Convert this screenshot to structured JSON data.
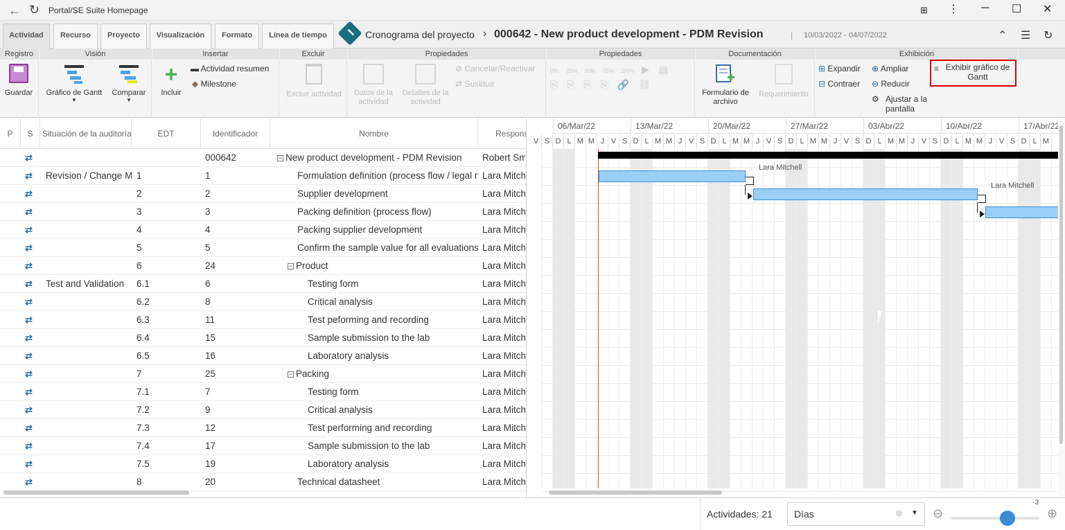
{
  "window": {
    "title": "Portal/SE Suite Homepage"
  },
  "tabs": [
    "Actividad",
    "Recurso",
    "Proyecto",
    "Visualización",
    "Formato",
    "Línea de tiempo"
  ],
  "breadcrumb": {
    "section": "Cronograma del proyecto",
    "separator": "›",
    "project": "000642 - New product development - PDM Revision",
    "divider": "|",
    "dates": "10/03/2022 - 04/07/2022"
  },
  "ribbon": {
    "groups": [
      "Registro",
      "Visión",
      "Insertar",
      "Excluir",
      "Propiedades",
      "Propiedades",
      "Documentación",
      "Exhibición"
    ],
    "guardar": "Guardar",
    "gantt": "Gráfico de Gantt",
    "comparar": "Comparar",
    "incluir": "Incluir",
    "actividad_resumen": "Actividad resumen",
    "milestone": "Milestone",
    "excluir_actividad": "Excluir actividad",
    "datos": "Datos de la actividad",
    "detalles": "Detalles de la actividad",
    "cancelar": "Cancelar/Reactivar",
    "sustituir": "Sustituir",
    "pct": [
      "0%",
      "25%",
      "50%",
      "75%",
      "100%"
    ],
    "formulario": "Formulario de archivo",
    "requerimiento": "Requerimiento",
    "expandir": "Expandir",
    "contraer": "Contraer",
    "ampliar": "Ampliar",
    "reducir": "Reducir",
    "ajustar": "Ajustar a la pantalla",
    "exhibir": "Exhibir gráfico de Gantt"
  },
  "grid": {
    "headers": [
      "P",
      "S",
      "Situación de la auditoría",
      "EDT",
      "Identificador",
      "Nombre",
      "Respons"
    ],
    "rows": [
      {
        "aud": "",
        "edt": "",
        "id": "000642",
        "name": "New product development - PDM Revision",
        "resp": "Robert Smith",
        "level": 0,
        "toggle": "−"
      },
      {
        "aud": "Revision / Change Management",
        "edt": "1",
        "id": "1",
        "name": "Formulation definition (process flow / legal requirements)",
        "resp": "Lara Mitchell",
        "level": 1,
        "toggle": ""
      },
      {
        "aud": "",
        "edt": "2",
        "id": "2",
        "name": "Supplier development",
        "resp": "Lara Mitchell",
        "level": 1,
        "toggle": ""
      },
      {
        "aud": "",
        "edt": "3",
        "id": "3",
        "name": "Packing definition (process flow)",
        "resp": "Lara Mitchell",
        "level": 1,
        "toggle": ""
      },
      {
        "aud": "",
        "edt": "4",
        "id": "4",
        "name": "Packing supplier development",
        "resp": "Lara Mitchell",
        "level": 1,
        "toggle": ""
      },
      {
        "aud": "",
        "edt": "5",
        "id": "5",
        "name": "Confirm the sample value for all evaluations",
        "resp": "Lara Mitchell",
        "level": 1,
        "toggle": ""
      },
      {
        "aud": "",
        "edt": "6",
        "id": "24",
        "name": "Product",
        "resp": "Lara Mitchell",
        "level": 1,
        "toggle": "−"
      },
      {
        "aud": "Test and Validation",
        "edt": "6.1",
        "id": "6",
        "name": "Testing form",
        "resp": "Lara Mitchell",
        "level": 2,
        "toggle": ""
      },
      {
        "aud": "",
        "edt": "6.2",
        "id": "8",
        "name": "Critical analysis",
        "resp": "Lara Mitchell",
        "level": 2,
        "toggle": ""
      },
      {
        "aud": "",
        "edt": "6.3",
        "id": "11",
        "name": "Test peforming and recording",
        "resp": "Lara Mitchell",
        "level": 2,
        "toggle": ""
      },
      {
        "aud": "",
        "edt": "6.4",
        "id": "15",
        "name": "Sample submission to the lab",
        "resp": "Lara Mitchell",
        "level": 2,
        "toggle": ""
      },
      {
        "aud": "",
        "edt": "6.5",
        "id": "16",
        "name": "Laboratory analysis",
        "resp": "Lara Mitchell",
        "level": 2,
        "toggle": ""
      },
      {
        "aud": "",
        "edt": "7",
        "id": "25",
        "name": "Packing",
        "resp": "Lara Mitchell",
        "level": 1,
        "toggle": "−"
      },
      {
        "aud": "",
        "edt": "7.1",
        "id": "7",
        "name": "Testing form",
        "resp": "Lara Mitchell",
        "level": 2,
        "toggle": ""
      },
      {
        "aud": "",
        "edt": "7.2",
        "id": "9",
        "name": "Critical analysis",
        "resp": "Lara Mitchell",
        "level": 2,
        "toggle": ""
      },
      {
        "aud": "",
        "edt": "7.3",
        "id": "12",
        "name": "Test performing and recording",
        "resp": "Lara Mitchell",
        "level": 2,
        "toggle": ""
      },
      {
        "aud": "",
        "edt": "7.4",
        "id": "17",
        "name": "Sample submission to the lab",
        "resp": "Lara Mitchell",
        "level": 2,
        "toggle": ""
      },
      {
        "aud": "",
        "edt": "7.5",
        "id": "19",
        "name": "Laboratory analysis",
        "resp": "Lara Mitchell",
        "level": 2,
        "toggle": ""
      },
      {
        "aud": "",
        "edt": "8",
        "id": "20",
        "name": "Technical datasheet",
        "resp": "Lara Mitchell",
        "level": 1,
        "toggle": ""
      }
    ]
  },
  "gantt": {
    "weeks": [
      "06/Mar/22",
      "13/Mar/22",
      "20/Mar/22",
      "27/Mar/22",
      "03/Abr/22",
      "10/Abr/22",
      "17/Abr/22"
    ],
    "days": [
      "V",
      "S",
      "D",
      "L",
      "M",
      "M",
      "J",
      "V",
      "S",
      "D",
      "L",
      "M",
      "M",
      "J",
      "V",
      "S",
      "D",
      "L",
      "M",
      "M",
      "J",
      "V",
      "S",
      "D",
      "L",
      "M",
      "M",
      "J",
      "V",
      "S",
      "D",
      "L",
      "M",
      "M",
      "J",
      "V",
      "S",
      "D",
      "L",
      "M",
      "M",
      "J",
      "V",
      "S",
      "D",
      "L",
      "M"
    ],
    "bars": [
      {
        "label": "Lara Mitchell"
      },
      {
        "label": "Lara Mitchell"
      },
      {
        "label": ""
      }
    ]
  },
  "footer": {
    "actividades": "Actividades: 21",
    "scale": "Días",
    "zoom": "-3"
  }
}
